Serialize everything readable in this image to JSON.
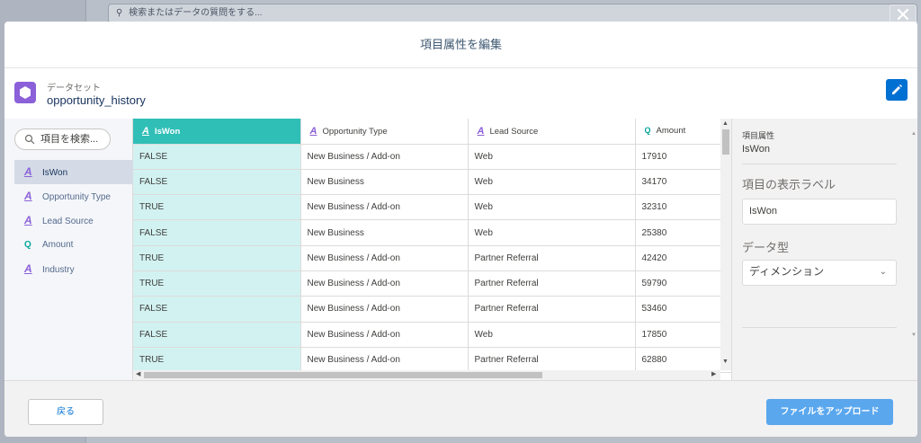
{
  "background": {
    "search_placeholder": "検索またはデータの質問をする..."
  },
  "modal": {
    "title": "項目属性を編集",
    "dataset_label": "データセット",
    "dataset_name": "opportunity_history"
  },
  "left_panel": {
    "search_placeholder": "項目を検索...",
    "fields": [
      {
        "label": "IsWon",
        "icon": "text-icon",
        "active": true
      },
      {
        "label": "Opportunity Type",
        "icon": "text-icon"
      },
      {
        "label": "Lead Source",
        "icon": "text-icon"
      },
      {
        "label": "Amount",
        "icon": "measure-icon"
      },
      {
        "label": "Industry",
        "icon": "text-icon"
      }
    ]
  },
  "grid": {
    "columns": [
      {
        "label": "IsWon",
        "icon_glyph": "A"
      },
      {
        "label": "Opportunity Type",
        "icon_glyph": "A"
      },
      {
        "label": "Lead Source",
        "icon_glyph": "A"
      },
      {
        "label": "Amount",
        "icon_glyph": "Q"
      }
    ],
    "rows": [
      [
        "FALSE",
        "New Business / Add-on",
        "Web",
        "17910"
      ],
      [
        "FALSE",
        "New Business",
        "Web",
        "34170"
      ],
      [
        "TRUE",
        "New Business / Add-on",
        "Web",
        "32310"
      ],
      [
        "FALSE",
        "New Business",
        "Web",
        "25380"
      ],
      [
        "TRUE",
        "New Business / Add-on",
        "Partner Referral",
        "42420"
      ],
      [
        "TRUE",
        "New Business / Add-on",
        "Partner Referral",
        "59790"
      ],
      [
        "FALSE",
        "New Business / Add-on",
        "Partner Referral",
        "53460"
      ],
      [
        "FALSE",
        "New Business / Add-on",
        "Web",
        "17850"
      ],
      [
        "TRUE",
        "New Business / Add-on",
        "Partner Referral",
        "62880"
      ]
    ]
  },
  "right_panel": {
    "attr_label": "項目属性",
    "attr_value": "IsWon",
    "display_label_heading": "項目の表示ラベル",
    "display_label_value": "IsWon",
    "data_type_heading": "データ型",
    "data_type_value": "ディメンション"
  },
  "footer": {
    "back_label": "戻る",
    "upload_label": "ファイルをアップロード"
  },
  "colors": {
    "accent_teal": "#2fbfb7",
    "brand_blue": "#0070d2",
    "upload_blue": "#5aa7ee",
    "dataset_purple": "#8b60d9"
  }
}
